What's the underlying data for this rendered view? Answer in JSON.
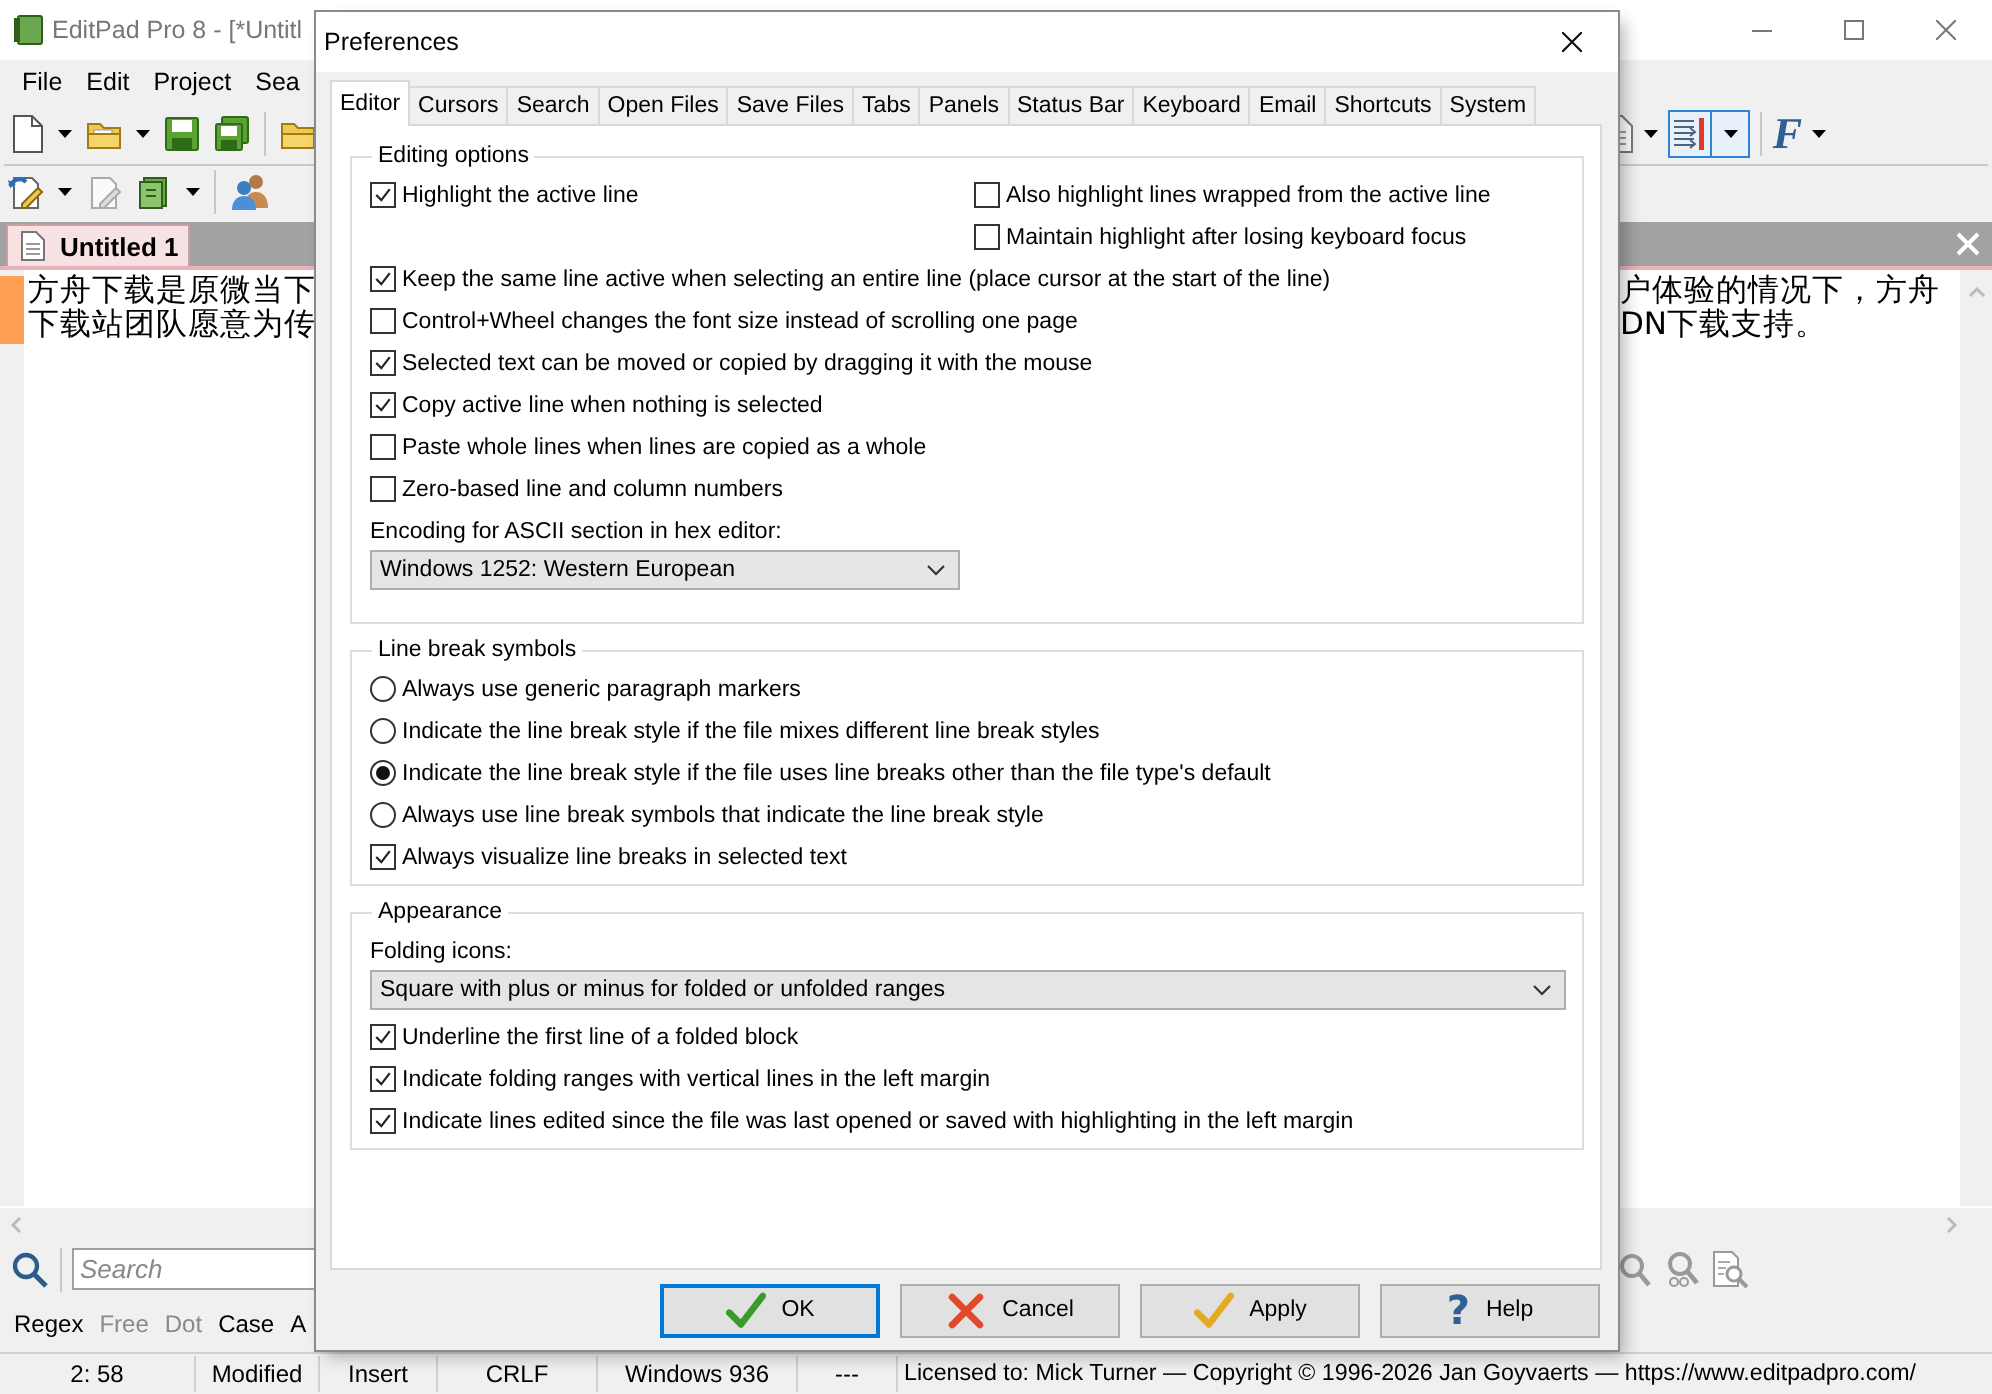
{
  "app_window": {
    "title": "EditPad Pro 8 - [*Untitl"
  },
  "menu_bar": [
    {
      "label": "File"
    },
    {
      "label": "Edit"
    },
    {
      "label": "Project"
    },
    {
      "label": "Sea"
    }
  ],
  "toolbar": {
    "toggle": {
      "selected": true
    },
    "font_glyph": "F"
  },
  "file_tabs": [
    {
      "label": "Untitled 1",
      "selected": true
    }
  ],
  "editor": {
    "lines": [
      {
        "start": "方舟下载是原微当下",
        "end": "户体验的情况下，方舟",
        "edited": true
      },
      {
        "start": "下载站团队愿意为传",
        "end": "DN下载支持。",
        "edited": true
      }
    ]
  },
  "search_bar": {
    "placeholder": "Search"
  },
  "search_options": [
    {
      "label": "Regex",
      "disabled": false
    },
    {
      "label": "Free",
      "disabled": true
    },
    {
      "label": "Dot",
      "disabled": true
    },
    {
      "label": "Case",
      "disabled": false
    },
    {
      "label": "A",
      "disabled": false
    }
  ],
  "status_bar": [
    "2: 58",
    "Modified",
    "Insert",
    "CRLF",
    "Windows 936",
    "---",
    "Licensed to: Mick Turner — Copyright © 1996-2026 Jan Goyvaerts — https://www.editpadpro.com/"
  ],
  "dialog": {
    "title": "Preferences",
    "tabs": [
      {
        "label": "Editor",
        "selected": true
      },
      {
        "label": "Cursors",
        "selected": false
      },
      {
        "label": "Search",
        "selected": false
      },
      {
        "label": "Open Files",
        "selected": false
      },
      {
        "label": "Save Files",
        "selected": false
      },
      {
        "label": "Tabs",
        "selected": false
      },
      {
        "label": "Panels",
        "selected": false
      },
      {
        "label": "Status Bar",
        "selected": false
      },
      {
        "label": "Keyboard",
        "selected": false
      },
      {
        "label": "Email",
        "selected": false
      },
      {
        "label": "Shortcuts",
        "selected": false
      },
      {
        "label": "System",
        "selected": false
      }
    ],
    "groups": [
      {
        "title": "Editing options",
        "items": [
          {
            "kind": "pair",
            "left": [
              {
                "label": "Highlight the active line",
                "checked": true
              }
            ],
            "right": [
              {
                "label": "Also highlight lines wrapped from the active line",
                "checked": false
              },
              {
                "label": "Maintain highlight after losing keyboard focus",
                "checked": false
              }
            ]
          },
          {
            "kind": "checkbox",
            "label": "Keep the same line active when selecting an entire line (place cursor at the start of the line)",
            "checked": true
          },
          {
            "kind": "checkbox",
            "label": "Control+Wheel changes the font size instead of scrolling one page",
            "checked": false
          },
          {
            "kind": "checkbox",
            "label": "Selected text can be moved or copied by dragging it with the mouse",
            "checked": true
          },
          {
            "kind": "checkbox",
            "label": "Copy active line when nothing is selected",
            "checked": true
          },
          {
            "kind": "checkbox",
            "label": "Paste whole lines when lines are copied as a whole",
            "checked": false
          },
          {
            "kind": "checkbox",
            "label": "Zero-based line and column numbers",
            "checked": false
          },
          {
            "kind": "dropdown",
            "label": "Encoding for ASCII section in hex editor:",
            "value": "Windows 1252: Western European"
          }
        ]
      },
      {
        "title": "Line break symbols",
        "items": [
          {
            "kind": "radio",
            "label": "Always use generic paragraph markers",
            "selected": false
          },
          {
            "kind": "radio",
            "label": "Indicate the line break style if the file mixes different line break styles",
            "selected": false
          },
          {
            "kind": "radio",
            "label": "Indicate the line break style if the file uses line breaks other than the file type's default",
            "selected": true
          },
          {
            "kind": "radio",
            "label": "Always use line break symbols that indicate the line break style",
            "selected": false
          },
          {
            "kind": "checkbox",
            "label": "Always visualize line breaks in selected text",
            "checked": true
          }
        ]
      },
      {
        "title": "Appearance",
        "items": [
          {
            "kind": "dropdown",
            "label": "Folding icons:",
            "value": "Square with plus or minus for folded or unfolded ranges"
          },
          {
            "kind": "checkbox",
            "label": "Underline the first line of a folded block",
            "checked": true
          },
          {
            "kind": "checkbox",
            "label": "Indicate folding ranges with vertical lines in the left margin",
            "checked": true
          },
          {
            "kind": "checkbox",
            "label": "Indicate lines edited since the file was last opened or saved with highlighting in the left margin",
            "checked": true
          }
        ]
      }
    ],
    "buttons": [
      {
        "kind": "ok",
        "label": "OK",
        "focused": true
      },
      {
        "kind": "cancel",
        "label": "Cancel",
        "focused": false
      },
      {
        "kind": "apply",
        "label": "Apply",
        "focused": false
      },
      {
        "kind": "help",
        "label": "Help",
        "glyph": "?",
        "focused": false
      }
    ]
  }
}
